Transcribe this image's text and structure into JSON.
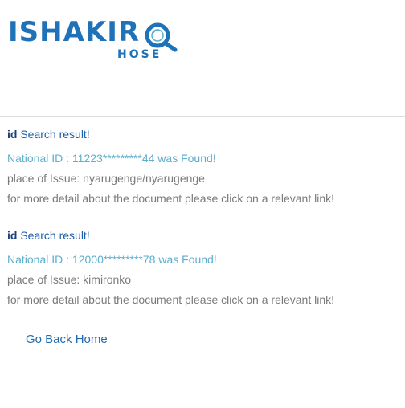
{
  "logo": {
    "word": "ISHAKIR",
    "sub": "HOSE",
    "icon": "magnifier-icon",
    "color": "#1f72b8"
  },
  "results": [
    {
      "heading_bold": "id",
      "heading_text": " Search result!",
      "found_text": "National ID : 11223*********44 was Found!",
      "place_text": "place of Issue: nyarugenge/nyarugenge",
      "detail_text": "for more detail about the document please click on a relevant link!"
    },
    {
      "heading_bold": "id",
      "heading_text": " Search result!",
      "found_text": "National ID : 12000*********78 was Found!",
      "place_text": "place of Issue: kimironko",
      "detail_text": "for more detail about the document please click on a relevant link!"
    }
  ],
  "back_link": "Go Back Home",
  "colors": {
    "brand": "#1f72b8",
    "found": "#5eaecd",
    "muted": "#7a7a7a",
    "divider": "#dedede"
  }
}
